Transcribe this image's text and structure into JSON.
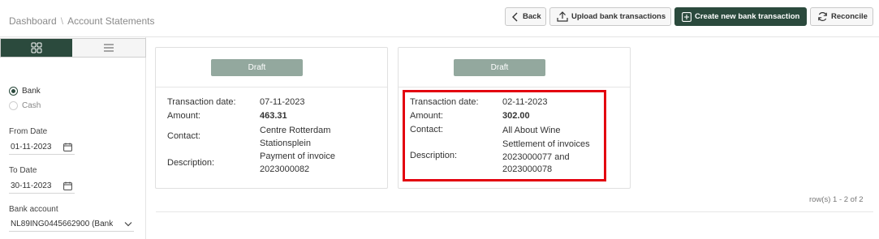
{
  "breadcrumb": {
    "items": [
      "Dashboard",
      "Account Statements"
    ],
    "separator": "\\"
  },
  "toolbar": {
    "back_label": "Back",
    "upload_label": "Upload bank transactions",
    "create_label": "Create new bank transaction",
    "reconcile_label": "Reconcile"
  },
  "sidebar": {
    "source": {
      "options": [
        "Bank",
        "Cash"
      ],
      "selected": "Bank"
    },
    "from_date": {
      "label": "From Date",
      "value": "01-11-2023"
    },
    "to_date": {
      "label": "To Date",
      "value": "30-11-2023"
    },
    "bank_account": {
      "label": "Bank account",
      "value": "NL89ING0445662900 (Bank"
    }
  },
  "labels": {
    "transaction_date": "Transaction date:",
    "amount": "Amount:",
    "contact": "Contact:",
    "description": "Description:"
  },
  "cards": [
    {
      "status": "Draft",
      "transaction_date": "07-11-2023",
      "amount": "463.31",
      "contact": "Centre Rotterdam Stationsplein",
      "description": "Payment of invoice 2023000082"
    },
    {
      "status": "Draft",
      "transaction_date": "02-11-2023",
      "amount": "302.00",
      "contact": "All About Wine",
      "description": "Settlement of invoices 2023000077 and 2023000078"
    }
  ],
  "pagination": {
    "text": "row(s) 1 - 2 of 2"
  },
  "colors": {
    "primary": "#2b4a3d",
    "badge": "#93a89e",
    "highlight": "#e3000f"
  }
}
